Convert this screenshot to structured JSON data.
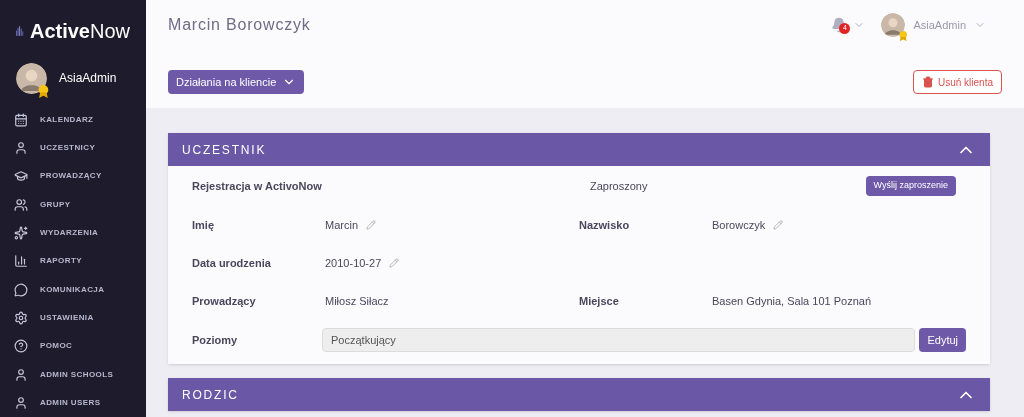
{
  "sidebar": {
    "logo": {
      "strong": "Active",
      "light": "Now"
    },
    "user": {
      "name": "AsiaAdmin"
    },
    "items": [
      {
        "label": "KALENDARZ"
      },
      {
        "label": "UCZESTNICY"
      },
      {
        "label": "PROWADZĄCY"
      },
      {
        "label": "GRUPY"
      },
      {
        "label": "WYDARZENIA"
      },
      {
        "label": "RAPORTY"
      },
      {
        "label": "KOMUNIKACJA"
      },
      {
        "label": "USTAWIENIA"
      },
      {
        "label": "POMOC"
      },
      {
        "label": "ADMIN SCHOOLS"
      },
      {
        "label": "ADMIN USERS"
      }
    ]
  },
  "header": {
    "title": "Marcin Borowczyk",
    "notifications": "4",
    "user": "AsiaAdmin"
  },
  "actions": {
    "menu_button": "Działania na kliencie",
    "delete_button": "Usuń klienta"
  },
  "sections": [
    {
      "title": "UCZESTNIK",
      "expanded": true,
      "registration": {
        "label": "Rejestracja w ActivoNow",
        "status": "Zaproszony",
        "button": "Wyślij zaproszenie"
      },
      "rows": [
        [
          {
            "label": "Imię",
            "value": "Marcin",
            "editable": true
          },
          {
            "label": "Nazwisko",
            "value": "Borowczyk",
            "editable": true
          }
        ],
        [
          {
            "label": "Data urodzenia",
            "value": "2010-10-27",
            "editable": true
          }
        ],
        [
          {
            "label": "Prowadzący",
            "value": "Miłosz Siłacz",
            "editable": false
          },
          {
            "label": "Miejsce",
            "value": "Basen Gdynia, Sala 101 Poznań",
            "editable": false
          }
        ]
      ],
      "levels": {
        "label": "Poziomy",
        "value": "Początkujący",
        "button": "Edytuj"
      }
    },
    {
      "title": "RODZIC",
      "expanded": true
    }
  ]
}
